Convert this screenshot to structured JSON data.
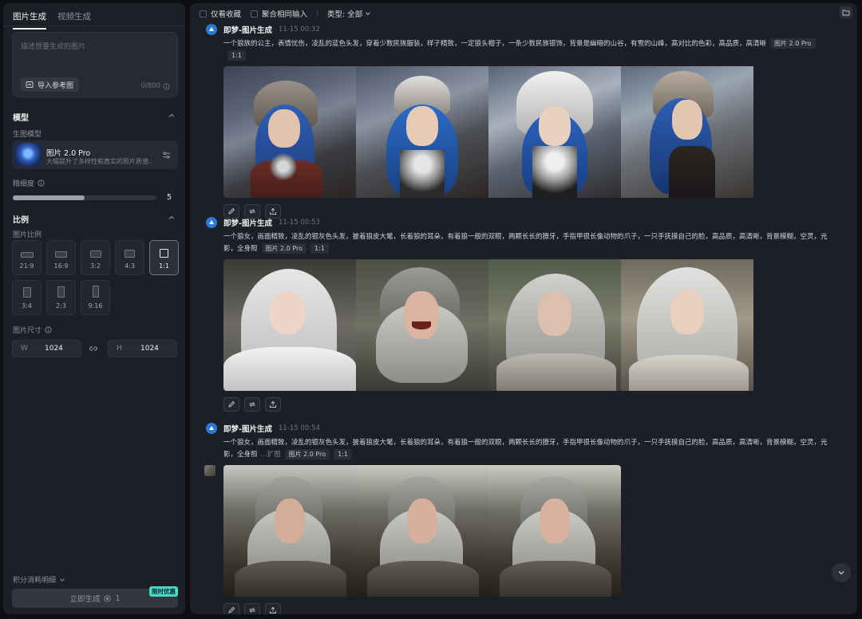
{
  "left": {
    "tabs": [
      "图片生成",
      "视频生成"
    ],
    "prompt_placeholder": "描述想要生成的图片",
    "import_ref_label": "导入参考图",
    "char_counter": "0/800",
    "model_section": "模型",
    "model_sub": "生图模型",
    "model_name": "图片 2.0 Pro",
    "model_desc": "大幅提升了多样性和真实的照片质感...",
    "detail_label": "精细度",
    "detail_value": 5,
    "detail_fraction": 0.5,
    "ratio_section": "比例",
    "ratio_sub": "图片比例",
    "ratios": [
      "21:9",
      "16:9",
      "3:2",
      "4:3",
      "1:1",
      "3:4",
      "2:3",
      "9:16"
    ],
    "ratio_selected": "1:1",
    "size_sub": "图片尺寸",
    "width_key": "W",
    "width_value": "1024",
    "height_key": "H",
    "height_value": "1024",
    "credits_label": "积分消耗明细",
    "generate_label": "立即生成",
    "generate_cost": "1",
    "promo_badge": "限时优惠"
  },
  "toolbar": {
    "only_fav": "仅看收藏",
    "merge_input": "聚合相同输入",
    "type_filter": "类型: 全部"
  },
  "records": [
    {
      "title": "即梦-图片生成",
      "time": "11-15   00:32",
      "prompt": "一个狼族的公主，表情忧伤，凌乱的蓝色头发，穿着少数民族服装，样子精致，一定狼头帽子，一条少数民族银饰，背景是幽暗的山谷，有雪的山峰，高对比的色彩，高品质，高清晰",
      "model_chip": "图片 2.0 Pro",
      "ratio_chip": "1:1",
      "image_count": 4
    },
    {
      "title": "即梦-图片生成",
      "time": "11-15   00:53",
      "prompt": "一个狼女，画面精致，凌乱的银灰色头发，披着狼皮大氅，长着狼的耳朵，有着狼一般的双眼，两颗长长的獠牙，手指甲很长像动物的爪子，一只手抚摸自己的脸，高品质，高清晰，背景模糊，空灵，光影，全身照",
      "model_chip": "图片 2.0 Pro",
      "ratio_chip": "1:1",
      "image_count": 4
    },
    {
      "title": "即梦-图片生成",
      "time": "11-15   00:54",
      "prompt": "一个狼女，画面精致，凌乱的银灰色头发，披着狼皮大氅，长着狼的耳朵，有着狼一般的双眼，两颗长长的獠牙，手指甲很长像动物的爪子，一只手抚摸自己的脸，高品质，高清晰，背景模糊，空灵，光影，全身照",
      "expand_link": "...扩图",
      "model_chip": "图片 2.0 Pro",
      "ratio_chip": "1:1",
      "image_count": 3
    }
  ]
}
